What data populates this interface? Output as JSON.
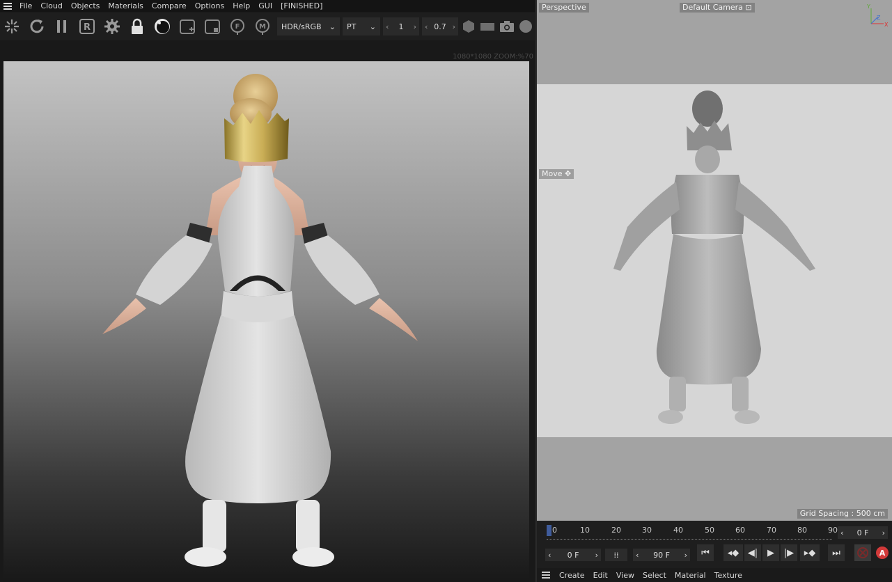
{
  "menu": [
    "File",
    "Cloud",
    "Objects",
    "Materials",
    "Compare",
    "Options",
    "Help",
    "GUI",
    "[FINISHED]"
  ],
  "toolbar": {
    "icons": [
      "render-region-icon",
      "refresh-icon",
      "pause-icon",
      "r-icon",
      "gear-icon",
      "lock-icon",
      "sphere-icon",
      "add-window-icon",
      "stop-window-icon",
      "f-icon",
      "m-icon"
    ],
    "color_space": "HDR/sRGB",
    "kernel": "PT",
    "spin1": "1",
    "spin2": "0.7"
  },
  "render": {
    "info": "1080*1080 ZOOM:%70"
  },
  "viewport": {
    "camera_mode": "Perspective",
    "camera": "Default Camera",
    "tool": "Move",
    "grid_spacing": "Grid Spacing : 500 cm",
    "axis_labels": [
      "Y",
      "Z",
      "X"
    ]
  },
  "timeline": {
    "ticks": [
      "0",
      "10",
      "20",
      "30",
      "40",
      "50",
      "60",
      "70",
      "80",
      "90"
    ],
    "current_frame": "0 F",
    "start_frame": "0 F",
    "end_frame": "90 F"
  },
  "bottom_menu": [
    "Create",
    "Edit",
    "View",
    "Select",
    "Material",
    "Texture"
  ]
}
